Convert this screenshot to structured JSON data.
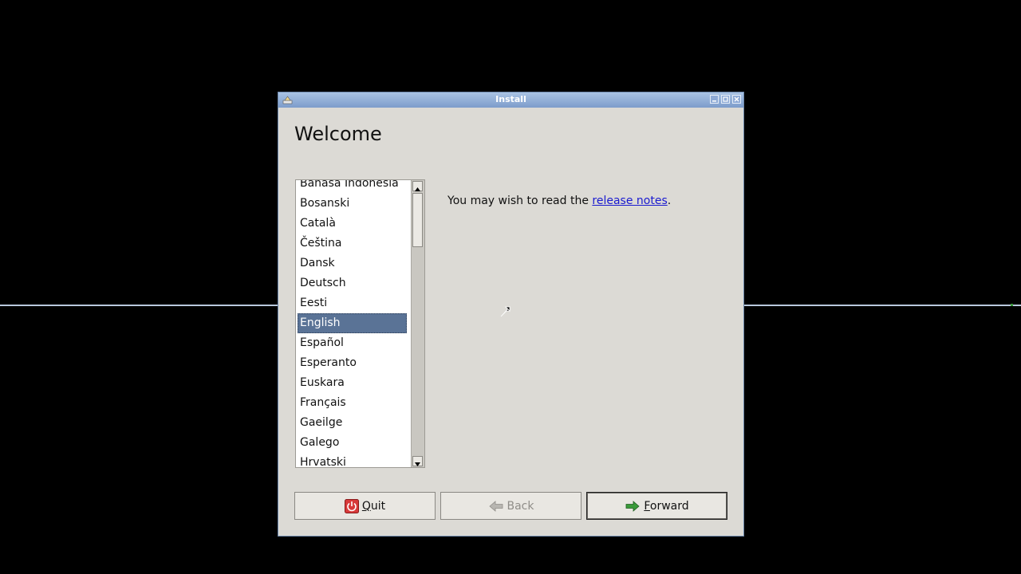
{
  "window": {
    "title": "Install"
  },
  "heading": "Welcome",
  "languages": [
    "Bahasa Indonesia",
    "Bosanski",
    "Català",
    "Čeština",
    "Dansk",
    "Deutsch",
    "Eesti",
    "English",
    "Español",
    "Esperanto",
    "Euskara",
    "Français",
    "Gaeilge",
    "Galego",
    "Hrvatski"
  ],
  "selected_language": "English",
  "notes": {
    "prefix": "You may wish to read the ",
    "link": "release notes",
    "suffix": "."
  },
  "buttons": {
    "quit": {
      "mnemonic": "Q",
      "rest": "uit"
    },
    "back": {
      "label": "Back"
    },
    "forward": {
      "mnemonic": "F",
      "rest": "orward"
    }
  },
  "colors": {
    "selection": "#5a7396",
    "link": "#1a1ad0",
    "titlebar": "#8eaad6"
  }
}
